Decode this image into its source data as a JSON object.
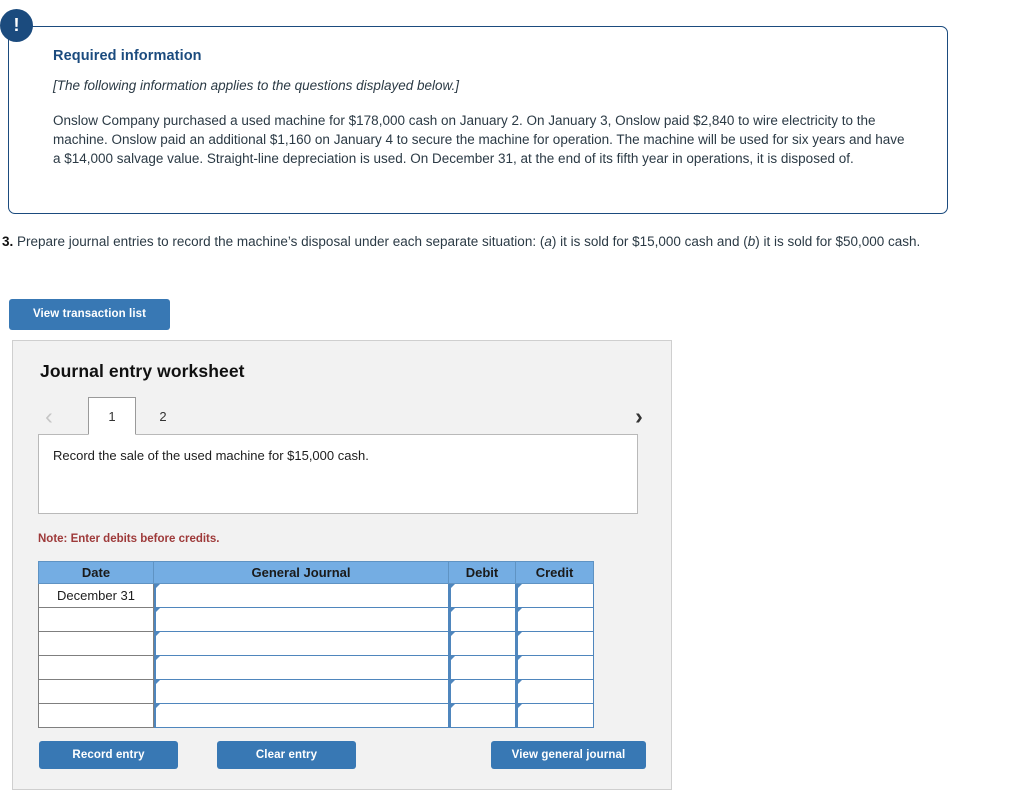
{
  "callout": {
    "icon": "exclamation-icon",
    "title": "Required information",
    "italic_note": "[The following information applies to the questions displayed below.]",
    "body": "Onslow Company purchased a used machine for $178,000 cash on January 2. On January 3, Onslow paid $2,840 to wire electricity to the machine. Onslow paid an additional $1,160 on January 4 to secure the machine for operation. The machine will be used for six years and have a $14,000 salvage value. Straight-line depreciation is used. On December 31, at the end of its fifth year in operations, it is disposed of.",
    "border_color": "#1b4b7e",
    "badge_color": "#1b4b7e"
  },
  "question": {
    "number": "3.",
    "part1": " Prepare journal entries to record the machine’s disposal under each separate situation: (",
    "label_a": "a",
    "part2": ") it is sold for $15,000 cash and (",
    "label_b": "b",
    "part3": ") it is sold for $50,000 cash."
  },
  "toolbar": {
    "view_transaction_list_label": "View transaction list"
  },
  "worksheet": {
    "title": "Journal entry worksheet",
    "tabs": [
      {
        "label": "1",
        "active": true
      },
      {
        "label": "2",
        "active": false
      }
    ],
    "nav": {
      "prev_icon": "chevron-left-icon",
      "next_icon": "chevron-right-icon",
      "prev_enabled": false,
      "next_enabled": true
    },
    "description": "Record the sale of the used machine for $15,000 cash.",
    "note": "Note: Enter debits before credits.",
    "note_color": "#9e3a3a",
    "table": {
      "headers": [
        "Date",
        "General Journal",
        "Debit",
        "Credit"
      ],
      "header_color": "#74ade3",
      "rows": [
        {
          "date": "December 31",
          "general_journal": "",
          "debit": "",
          "credit": ""
        },
        {
          "date": "",
          "general_journal": "",
          "debit": "",
          "credit": ""
        },
        {
          "date": "",
          "general_journal": "",
          "debit": "",
          "credit": ""
        },
        {
          "date": "",
          "general_journal": "",
          "debit": "",
          "credit": ""
        },
        {
          "date": "",
          "general_journal": "",
          "debit": "",
          "credit": ""
        },
        {
          "date": "",
          "general_journal": "",
          "debit": "",
          "credit": ""
        }
      ]
    },
    "buttons": {
      "record_entry": "Record entry",
      "clear_entry": "Clear entry",
      "view_general_journal": "View general journal",
      "color": "#3878b4"
    }
  }
}
